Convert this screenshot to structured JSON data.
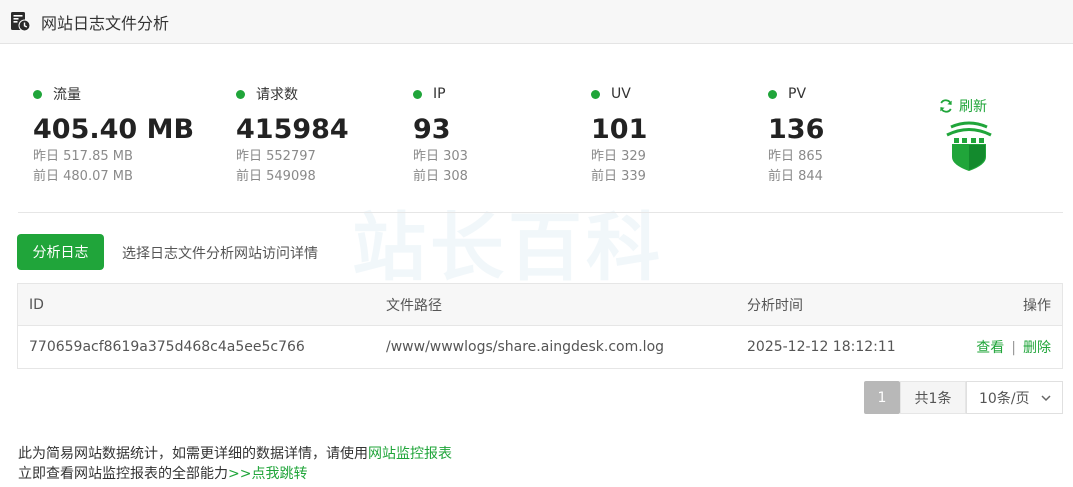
{
  "window": {
    "title": "网站日志文件分析",
    "app_icon": "log-file-icon"
  },
  "watermark": {
    "text": "站长百科"
  },
  "stats": [
    {
      "label": "流量",
      "value": "405.40 MB",
      "yesterday": "昨日 517.85 MB",
      "day_before": "前日 480.07 MB"
    },
    {
      "label": "请求数",
      "value": "415984",
      "yesterday": "昨日 552797",
      "day_before": "前日 549098"
    },
    {
      "label": "IP",
      "value": "93",
      "yesterday": "昨日 303",
      "day_before": "前日 308"
    },
    {
      "label": "UV",
      "value": "101",
      "yesterday": "昨日 329",
      "day_before": "前日 339"
    },
    {
      "label": "PV",
      "value": "136",
      "yesterday": "昨日 865",
      "day_before": "前日 844"
    }
  ],
  "refresh": {
    "label": "刷新",
    "icon": "refresh-icon"
  },
  "actions": {
    "analyze_label": "分析日志",
    "hint": "选择日志文件分析网站访问详情"
  },
  "table": {
    "headers": {
      "id": "ID",
      "path": "文件路径",
      "time": "分析时间",
      "op": "操作"
    },
    "rows": [
      {
        "id": "770659acf8619a375d468c4a5ee5c766",
        "path": "/www/wwwlogs/share.aingdesk.com.log",
        "time": "2025-12-12 18:12:11",
        "view": "查看",
        "sep": "|",
        "delete": "删除"
      }
    ]
  },
  "pagination": {
    "current_page": "1",
    "total": "共1条",
    "page_size": "10条/页"
  },
  "footer": {
    "line1_text": "此为简易网站数据统计，如需更详细的数据详情，请使用",
    "line1_link": "网站监控报表",
    "line2_text": "立即查看网站监控报表的全部能力",
    "line2_link": ">>点我跳转"
  },
  "colors": {
    "accent": "#20a53a",
    "header_bg": "#f7f7f7",
    "pager_active": "#b8b8b8"
  }
}
